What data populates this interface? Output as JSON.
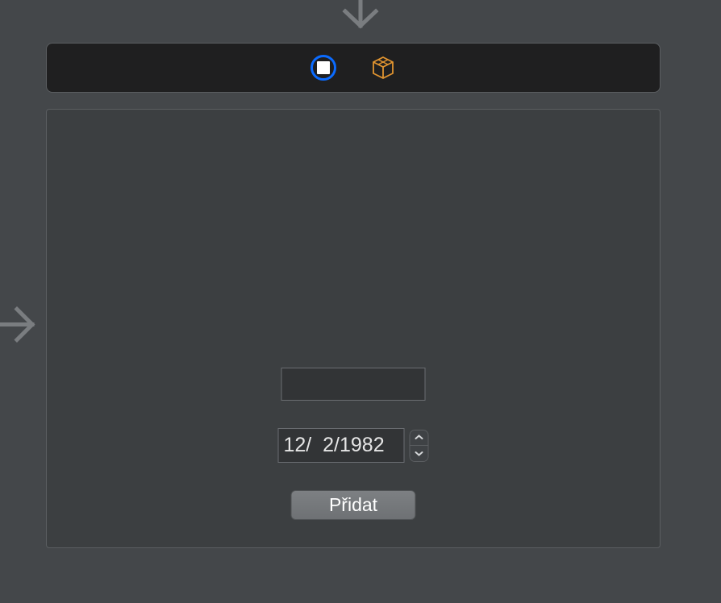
{
  "toolbar": {
    "stop_icon": "stop-icon",
    "box_icon": "box-3d-icon"
  },
  "form": {
    "text_value": "",
    "date_value": "12/  2/1982",
    "add_label": "Přidat"
  }
}
